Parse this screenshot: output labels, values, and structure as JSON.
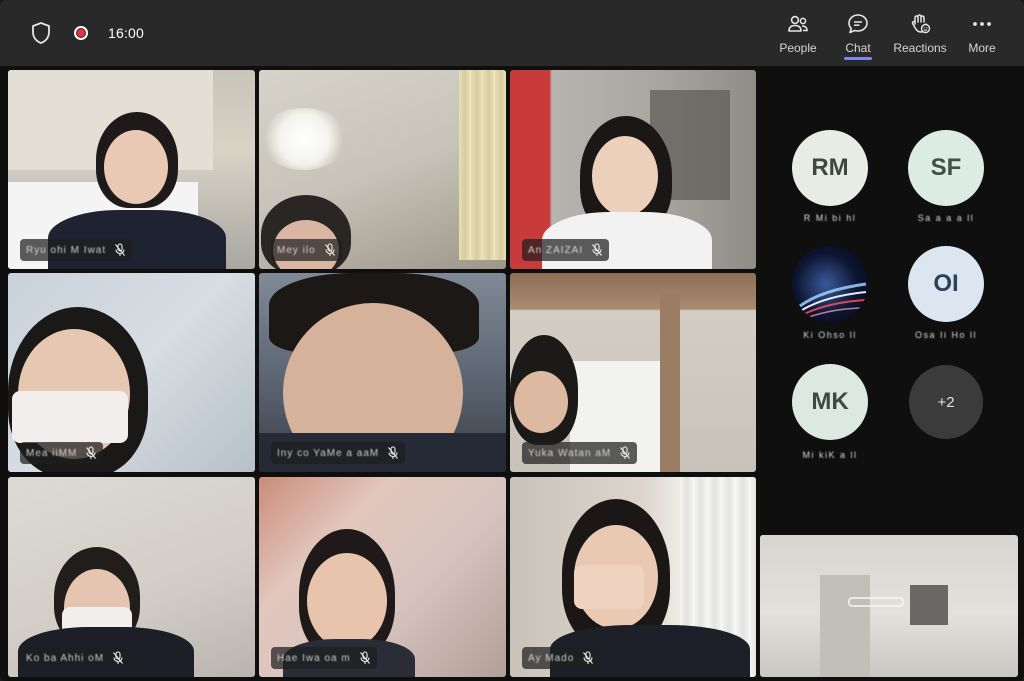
{
  "toolbar": {
    "time": "16:00",
    "people_label": "People",
    "chat_label": "Chat",
    "reactions_label": "Reactions",
    "more_label": "More"
  },
  "tiles": [
    {
      "name": "Ryu  ohi  M  Iwat"
    },
    {
      "name": "Mey  ilo"
    },
    {
      "name": "An  ZAIZAI"
    },
    {
      "name": "Mea  iiMM"
    },
    {
      "name": "Iny  co  YaMe  a  aaM"
    },
    {
      "name": "Yuka  Watan  aM"
    },
    {
      "name": "Ko  ba  Ahhi  oM"
    },
    {
      "name": "Hae  Iwa  oa  m"
    },
    {
      "name": "Ay  Mado"
    }
  ],
  "roster": [
    {
      "initials": "RM",
      "name": "R  Mi  bi  hl"
    },
    {
      "initials": "SF",
      "name": "Sa  a  a  a  ll"
    },
    {
      "initials": "",
      "name": "Ki  Ohso  ll"
    },
    {
      "initials": "OI",
      "name": "Osa  Ii  Ho  ll"
    },
    {
      "initials": "MK",
      "name": "Mi  kiK  a  ll"
    },
    {
      "initials": "+2",
      "name": ""
    }
  ],
  "colors": {
    "topbar": "#292929",
    "stage": "#0f0f0f",
    "accent": "#7f85f5",
    "record": "#e5323f"
  },
  "icons": [
    "shield-icon",
    "record-icon",
    "people-icon",
    "chat-icon",
    "reactions-icon",
    "more-icon",
    "mic-off-icon"
  ]
}
